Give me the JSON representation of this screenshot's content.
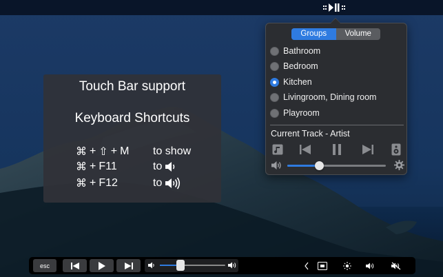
{
  "info": {
    "line1": "Touch Bar support",
    "line2": "Keyboard Shortcuts",
    "shortcuts": [
      {
        "keys": [
          "⌘",
          "+",
          "⇧",
          "+",
          "M"
        ],
        "action": "to show",
        "action_icon": ""
      },
      {
        "keys": [
          "⌘",
          "+",
          "F11"
        ],
        "action": "to",
        "action_icon": "speaker-low-icon"
      },
      {
        "keys": [
          "⌘",
          "+",
          "F12"
        ],
        "action": "to",
        "action_icon": "speaker-high-icon"
      }
    ]
  },
  "popover": {
    "tabs": [
      "Groups",
      "Volume"
    ],
    "active_tab": "Groups",
    "groups": [
      {
        "label": "Bathroom",
        "selected": false
      },
      {
        "label": "Bedroom",
        "selected": false
      },
      {
        "label": "Kitchen",
        "selected": true
      },
      {
        "label": "Livingroom, Dining room",
        "selected": false
      },
      {
        "label": "Playroom",
        "selected": false
      }
    ],
    "track": "Current Track - Artist",
    "volume_fraction": 0.32
  },
  "touchbar": {
    "esc_label": "esc",
    "volume_fraction": 0.32
  },
  "colors": {
    "accent": "#2f7be0",
    "panel": "#2b2d31",
    "overlay": "#303238"
  }
}
